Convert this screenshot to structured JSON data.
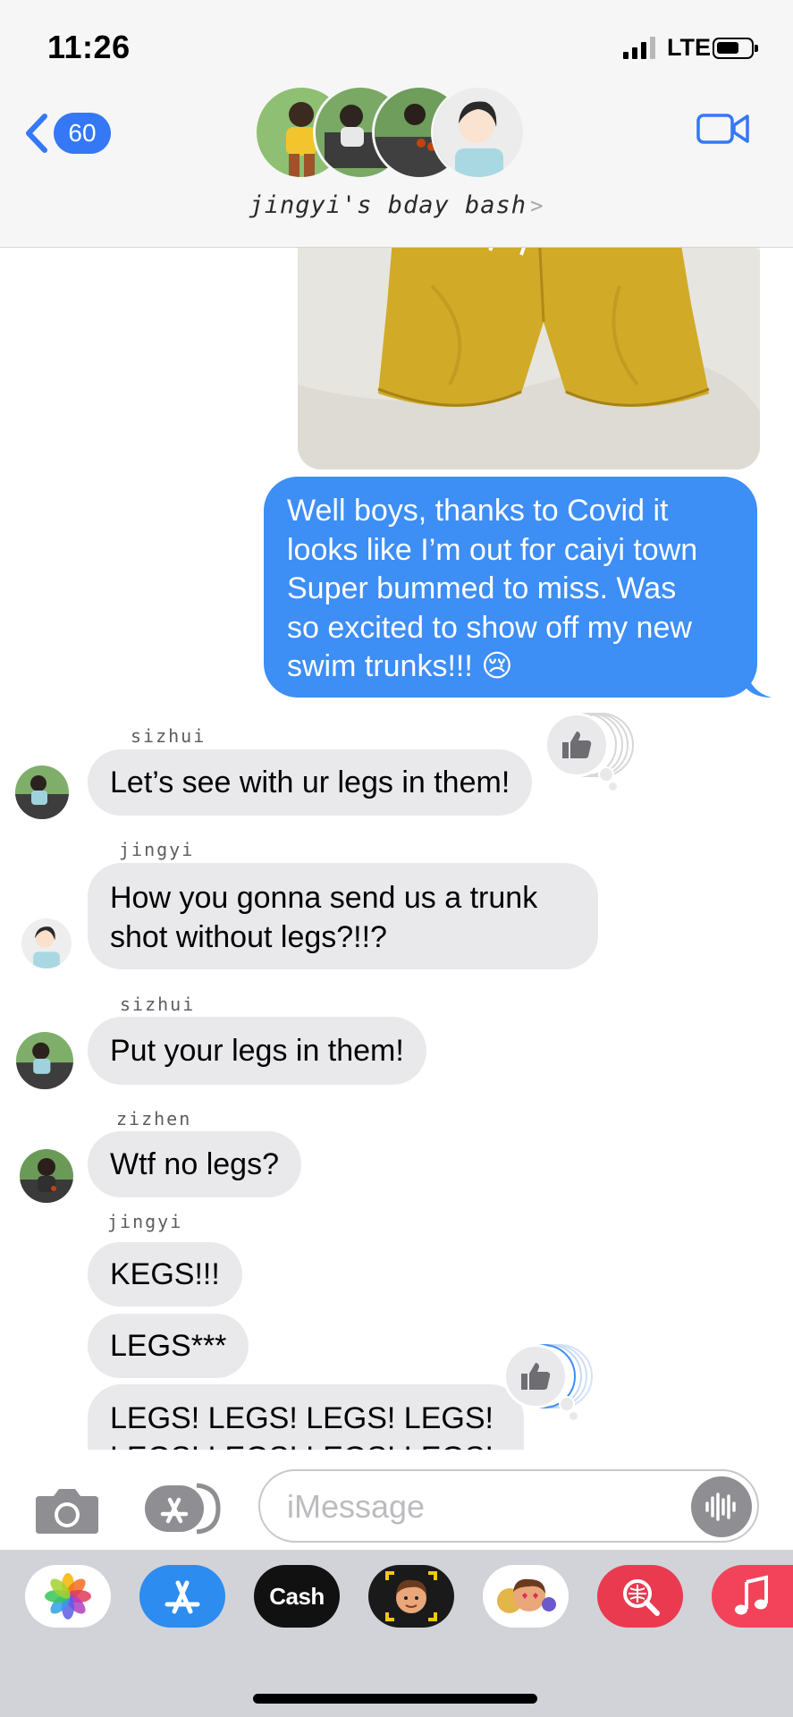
{
  "status_bar": {
    "time": "11:26",
    "network": "LTE"
  },
  "header": {
    "back_count": "60",
    "group_name": "jingyi's bday bash",
    "group_chevron": ">"
  },
  "messages": {
    "outgoing_text": "Well boys, thanks to Covid it looks like I’m out for caiyi town Super bummed to miss. Was so excited to show off my new swim trunks!!! 😢",
    "outgoing_lines": [
      "Well boys, thanks to Covid it",
      "looks like I’m out for caiyi town",
      "Super bummed to miss. Was",
      "so excited to show off my new",
      "swim trunks!!! 😢"
    ],
    "m1": {
      "sender": "sizhui",
      "text": "Let’s see with ur legs in them!"
    },
    "m2": {
      "sender": "jingyi",
      "lines": [
        "How you gonna send us a trunk",
        "shot without legs?!!?"
      ]
    },
    "m3": {
      "sender": "sizhui",
      "text": "Put your legs in them!"
    },
    "m4": {
      "sender": "zizhen",
      "text": "Wtf no legs?"
    },
    "m5": {
      "sender": "jingyi",
      "text": "KEGS!!!"
    },
    "m6": {
      "text": "LEGS***"
    },
    "m7": {
      "lines": [
        "LEGS! LEGS! LEGS! LEGS!",
        "LEGS! LEGS! LEGS! LEGS!"
      ]
    }
  },
  "compose": {
    "placeholder": "iMessage"
  },
  "drawer": {
    "apps": [
      "photos-app",
      "app-store-app",
      "apple-cash-app",
      "memoji-app",
      "memoji-stickers-app",
      "image-search-app",
      "music-app"
    ],
    "cash_label": "Cash",
    "cash_logo": ""
  },
  "colors": {
    "imessage_blue": "#3d8ef5",
    "incoming_gray": "#e9e9eb",
    "badge_blue": "#3478f6",
    "header_bg": "#f6f6f6",
    "drawer_bg": "#d1d3d9"
  }
}
